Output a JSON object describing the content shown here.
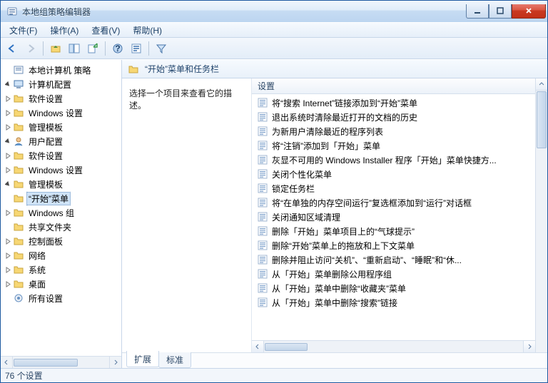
{
  "window": {
    "title": "本地组策略编辑器"
  },
  "menu": {
    "file": "文件(F)",
    "action": "操作(A)",
    "view": "查看(V)",
    "help": "帮助(H)"
  },
  "tree": {
    "root": "本地计算机 策略",
    "computer": "计算机配置",
    "c_soft": "软件设置",
    "c_win": "Windows 设置",
    "c_admin": "管理模板",
    "user": "用户配置",
    "u_soft": "软件设置",
    "u_win": "Windows 设置",
    "u_admin": "管理模板",
    "start": "“开始”菜单",
    "wincomp": "Windows 组",
    "shared": "共享文件夹",
    "control": "控制面板",
    "network": "网络",
    "system": "系统",
    "desktop": "桌面",
    "allset": "所有设置"
  },
  "header": {
    "title": "“开始”菜单和任务栏"
  },
  "desc": "选择一个项目来查看它的描述。",
  "listhdr": "设置",
  "items": [
    "将“搜索 Internet”链接添加到“开始”菜单",
    "退出系统时清除最近打开的文档的历史",
    "为新用户清除最近的程序列表",
    "将“注销”添加到「开始」菜单",
    "灰显不可用的 Windows Installer 程序「开始」菜单快捷方...",
    "关闭个性化菜单",
    "锁定任务栏",
    "将“在单独的内存空间运行”复选框添加到“运行”对话框",
    "关闭通知区域清理",
    "删除「开始」菜单项目上的“气球提示”",
    "删除“开始”菜单上的拖放和上下文菜单",
    "删除并阻止访问“关机”、“重新启动”、“睡眠”和“休...",
    "从「开始」菜单删除公用程序组",
    "从「开始」菜单中删除“收藏夹”菜单",
    "从「开始」菜单中删除“搜索”链接"
  ],
  "tabs": {
    "ext": "扩展",
    "std": "标准"
  },
  "status": "76 个设置"
}
